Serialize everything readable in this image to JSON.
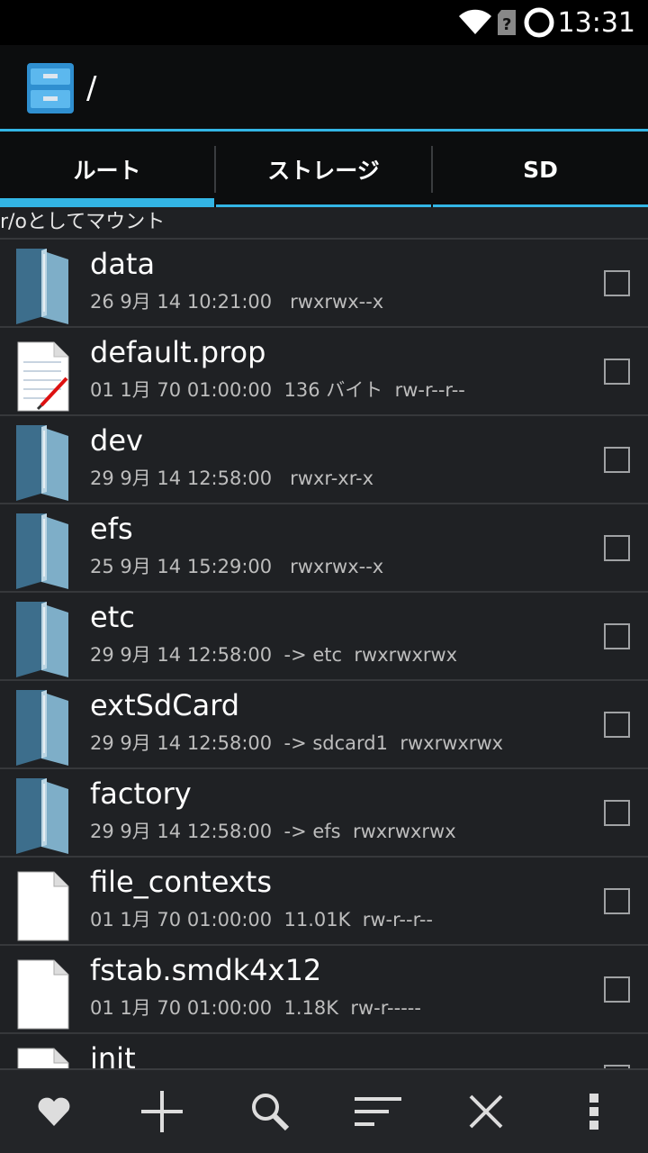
{
  "status_bar": {
    "time": "13:31",
    "icons": [
      "wifi-icon",
      "sim-unknown-icon",
      "sync-icon"
    ]
  },
  "action_bar": {
    "title": "/",
    "app_icon": "file-cabinet-icon"
  },
  "tabs": [
    {
      "label": "ルート",
      "active": true
    },
    {
      "label": "ストレージ",
      "active": false
    },
    {
      "label": "SD",
      "active": false
    }
  ],
  "mount_label": "r/oとしてマウント",
  "files": [
    {
      "name": "data",
      "meta": "26 9月 14 10:21:00   rwxrwx--x",
      "icon": "folder-icon"
    },
    {
      "name": "default.prop",
      "meta": "01 1月 70 01:00:00  136 バイト  rw-r--r--",
      "icon": "text-file-icon"
    },
    {
      "name": "dev",
      "meta": "29 9月 14 12:58:00   rwxr-xr-x",
      "icon": "folder-icon"
    },
    {
      "name": "efs",
      "meta": "25 9月 14 15:29:00   rwxrwx--x",
      "icon": "folder-icon"
    },
    {
      "name": "etc",
      "meta": "29 9月 14 12:58:00  -> etc  rwxrwxrwx",
      "icon": "folder-icon"
    },
    {
      "name": "extSdCard",
      "meta": "29 9月 14 12:58:00  -> sdcard1  rwxrwxrwx",
      "icon": "folder-icon"
    },
    {
      "name": "factory",
      "meta": "29 9月 14 12:58:00  -> efs  rwxrwxrwx",
      "icon": "folder-icon"
    },
    {
      "name": "file_contexts",
      "meta": "01 1月 70 01:00:00  11.01K  rw-r--r--",
      "icon": "file-icon"
    },
    {
      "name": "fstab.smdk4x12",
      "meta": "01 1月 70 01:00:00  1.18K  rw-r-----",
      "icon": "file-icon"
    },
    {
      "name": "init",
      "meta": "",
      "icon": "file-icon"
    }
  ],
  "bottom_bar": [
    "favorites-heart-icon",
    "add-icon",
    "search-icon",
    "sort-icon",
    "close-icon",
    "overflow-menu-icon"
  ],
  "colors": {
    "accent": "#33b5e5",
    "background": "#1f2124",
    "bar": "#0c0d0e"
  }
}
